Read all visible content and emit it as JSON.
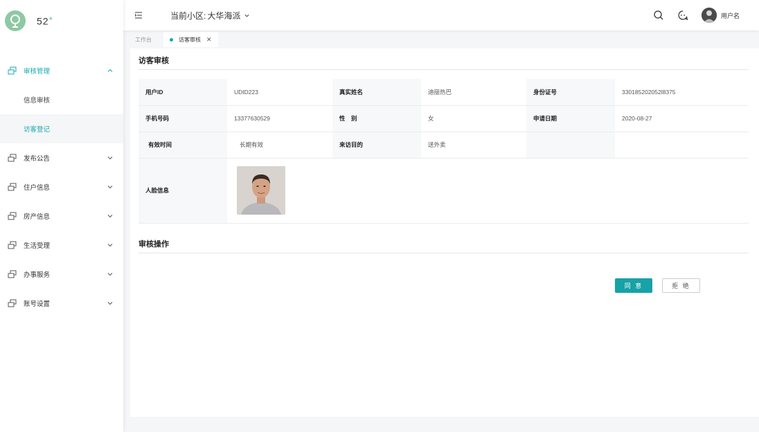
{
  "brand": {
    "text": "52",
    "sup": "+"
  },
  "sidebar": {
    "items": [
      {
        "label": "审核管理",
        "active": true,
        "expanded": true,
        "children": [
          {
            "label": "信息审核"
          },
          {
            "label": "访客登记"
          }
        ]
      },
      {
        "label": "发布公告"
      },
      {
        "label": "住户信息"
      },
      {
        "label": "房产信息"
      },
      {
        "label": "生活受理"
      },
      {
        "label": "办事服务"
      },
      {
        "label": "账号设置"
      }
    ]
  },
  "header": {
    "community_label": "当前小区:",
    "community_value": "大华海派",
    "username": "用户名"
  },
  "tabs": [
    {
      "label": "工作台"
    },
    {
      "label": "访客审核"
    }
  ],
  "page": {
    "title": "访客审核",
    "fields": {
      "user_id_label": "用户ID",
      "user_id": "UDID223",
      "real_name_label": "真实姓名",
      "real_name": "迪丽热巴",
      "id_no_label": "身份证号",
      "id_no": "330185202052l8375",
      "phone_label": "手机号码",
      "phone": "13377630529",
      "gender_label": "性　别",
      "gender": "女",
      "apply_date_label": "申请日期",
      "apply_date": "2020-08-27",
      "valid_label": "有效时间",
      "valid": "长期有效",
      "purpose_label": "来访目的",
      "purpose": "送外卖",
      "face_label": "人脸信息"
    },
    "ops_title": "审核操作",
    "agree_label": "同 意",
    "reject_label": "拒 绝"
  },
  "colors": {
    "accent": "#17a2a6",
    "logo": "#8dc9a3"
  }
}
